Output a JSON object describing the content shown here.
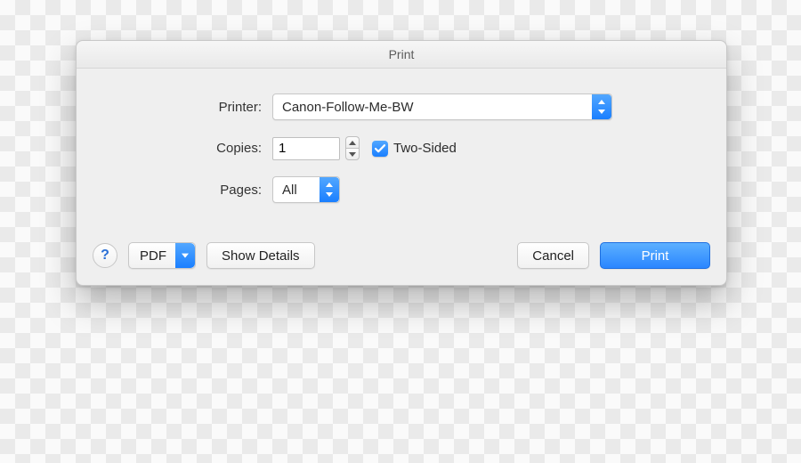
{
  "dialog": {
    "title": "Print",
    "printer_label": "Printer:",
    "printer_value": "Canon-Follow-Me-BW",
    "copies_label": "Copies:",
    "copies_value": "1",
    "two_sided_label": "Two-Sided",
    "two_sided_checked": true,
    "pages_label": "Pages:",
    "pages_value": "All"
  },
  "footer": {
    "help": "?",
    "pdf": "PDF",
    "show_details": "Show Details",
    "cancel": "Cancel",
    "print": "Print"
  }
}
